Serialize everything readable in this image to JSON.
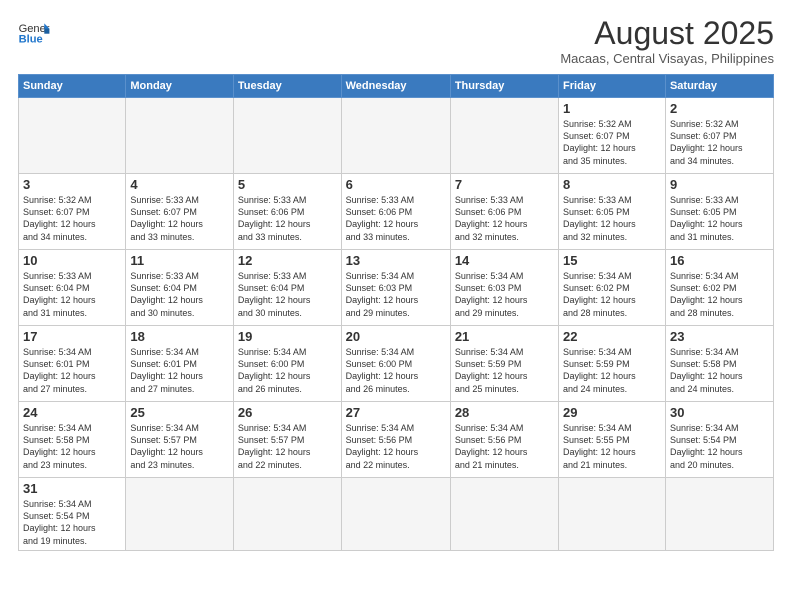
{
  "header": {
    "logo_general": "General",
    "logo_blue": "Blue",
    "month_year": "August 2025",
    "location": "Macaas, Central Visayas, Philippines"
  },
  "weekdays": [
    "Sunday",
    "Monday",
    "Tuesday",
    "Wednesday",
    "Thursday",
    "Friday",
    "Saturday"
  ],
  "weeks": [
    [
      {
        "day": "",
        "info": ""
      },
      {
        "day": "",
        "info": ""
      },
      {
        "day": "",
        "info": ""
      },
      {
        "day": "",
        "info": ""
      },
      {
        "day": "",
        "info": ""
      },
      {
        "day": "1",
        "info": "Sunrise: 5:32 AM\nSunset: 6:07 PM\nDaylight: 12 hours\nand 35 minutes."
      },
      {
        "day": "2",
        "info": "Sunrise: 5:32 AM\nSunset: 6:07 PM\nDaylight: 12 hours\nand 34 minutes."
      }
    ],
    [
      {
        "day": "3",
        "info": "Sunrise: 5:32 AM\nSunset: 6:07 PM\nDaylight: 12 hours\nand 34 minutes."
      },
      {
        "day": "4",
        "info": "Sunrise: 5:33 AM\nSunset: 6:07 PM\nDaylight: 12 hours\nand 33 minutes."
      },
      {
        "day": "5",
        "info": "Sunrise: 5:33 AM\nSunset: 6:06 PM\nDaylight: 12 hours\nand 33 minutes."
      },
      {
        "day": "6",
        "info": "Sunrise: 5:33 AM\nSunset: 6:06 PM\nDaylight: 12 hours\nand 33 minutes."
      },
      {
        "day": "7",
        "info": "Sunrise: 5:33 AM\nSunset: 6:06 PM\nDaylight: 12 hours\nand 32 minutes."
      },
      {
        "day": "8",
        "info": "Sunrise: 5:33 AM\nSunset: 6:05 PM\nDaylight: 12 hours\nand 32 minutes."
      },
      {
        "day": "9",
        "info": "Sunrise: 5:33 AM\nSunset: 6:05 PM\nDaylight: 12 hours\nand 31 minutes."
      }
    ],
    [
      {
        "day": "10",
        "info": "Sunrise: 5:33 AM\nSunset: 6:04 PM\nDaylight: 12 hours\nand 31 minutes."
      },
      {
        "day": "11",
        "info": "Sunrise: 5:33 AM\nSunset: 6:04 PM\nDaylight: 12 hours\nand 30 minutes."
      },
      {
        "day": "12",
        "info": "Sunrise: 5:33 AM\nSunset: 6:04 PM\nDaylight: 12 hours\nand 30 minutes."
      },
      {
        "day": "13",
        "info": "Sunrise: 5:34 AM\nSunset: 6:03 PM\nDaylight: 12 hours\nand 29 minutes."
      },
      {
        "day": "14",
        "info": "Sunrise: 5:34 AM\nSunset: 6:03 PM\nDaylight: 12 hours\nand 29 minutes."
      },
      {
        "day": "15",
        "info": "Sunrise: 5:34 AM\nSunset: 6:02 PM\nDaylight: 12 hours\nand 28 minutes."
      },
      {
        "day": "16",
        "info": "Sunrise: 5:34 AM\nSunset: 6:02 PM\nDaylight: 12 hours\nand 28 minutes."
      }
    ],
    [
      {
        "day": "17",
        "info": "Sunrise: 5:34 AM\nSunset: 6:01 PM\nDaylight: 12 hours\nand 27 minutes."
      },
      {
        "day": "18",
        "info": "Sunrise: 5:34 AM\nSunset: 6:01 PM\nDaylight: 12 hours\nand 27 minutes."
      },
      {
        "day": "19",
        "info": "Sunrise: 5:34 AM\nSunset: 6:00 PM\nDaylight: 12 hours\nand 26 minutes."
      },
      {
        "day": "20",
        "info": "Sunrise: 5:34 AM\nSunset: 6:00 PM\nDaylight: 12 hours\nand 26 minutes."
      },
      {
        "day": "21",
        "info": "Sunrise: 5:34 AM\nSunset: 5:59 PM\nDaylight: 12 hours\nand 25 minutes."
      },
      {
        "day": "22",
        "info": "Sunrise: 5:34 AM\nSunset: 5:59 PM\nDaylight: 12 hours\nand 24 minutes."
      },
      {
        "day": "23",
        "info": "Sunrise: 5:34 AM\nSunset: 5:58 PM\nDaylight: 12 hours\nand 24 minutes."
      }
    ],
    [
      {
        "day": "24",
        "info": "Sunrise: 5:34 AM\nSunset: 5:58 PM\nDaylight: 12 hours\nand 23 minutes."
      },
      {
        "day": "25",
        "info": "Sunrise: 5:34 AM\nSunset: 5:57 PM\nDaylight: 12 hours\nand 23 minutes."
      },
      {
        "day": "26",
        "info": "Sunrise: 5:34 AM\nSunset: 5:57 PM\nDaylight: 12 hours\nand 22 minutes."
      },
      {
        "day": "27",
        "info": "Sunrise: 5:34 AM\nSunset: 5:56 PM\nDaylight: 12 hours\nand 22 minutes."
      },
      {
        "day": "28",
        "info": "Sunrise: 5:34 AM\nSunset: 5:56 PM\nDaylight: 12 hours\nand 21 minutes."
      },
      {
        "day": "29",
        "info": "Sunrise: 5:34 AM\nSunset: 5:55 PM\nDaylight: 12 hours\nand 21 minutes."
      },
      {
        "day": "30",
        "info": "Sunrise: 5:34 AM\nSunset: 5:54 PM\nDaylight: 12 hours\nand 20 minutes."
      }
    ],
    [
      {
        "day": "31",
        "info": "Sunrise: 5:34 AM\nSunset: 5:54 PM\nDaylight: 12 hours\nand 19 minutes."
      },
      {
        "day": "",
        "info": ""
      },
      {
        "day": "",
        "info": ""
      },
      {
        "day": "",
        "info": ""
      },
      {
        "day": "",
        "info": ""
      },
      {
        "day": "",
        "info": ""
      },
      {
        "day": "",
        "info": ""
      }
    ]
  ]
}
